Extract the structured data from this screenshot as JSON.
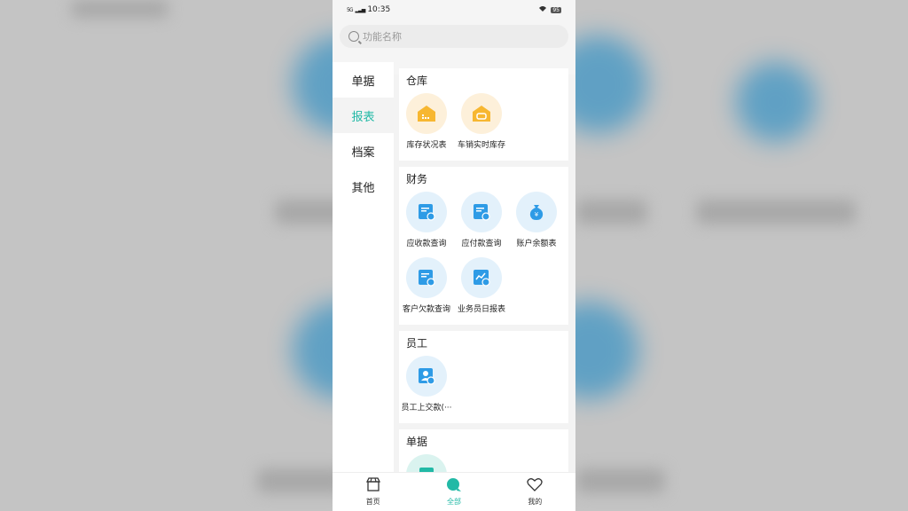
{
  "status_bar": {
    "network": "5G",
    "time": "10:35",
    "battery": "95"
  },
  "search": {
    "placeholder": "功能名称"
  },
  "sidebar": {
    "items": [
      {
        "label": "单据",
        "active": false
      },
      {
        "label": "报表",
        "active": true
      },
      {
        "label": "档案",
        "active": false
      },
      {
        "label": "其他",
        "active": false
      }
    ]
  },
  "sections": [
    {
      "title": "仓库",
      "items": [
        {
          "label": "库存状况表",
          "icon": "warehouse-icon"
        },
        {
          "label": "车销实时库存",
          "icon": "van-inventory-icon"
        }
      ]
    },
    {
      "title": "财务",
      "items": [
        {
          "label": "应收款查询",
          "icon": "receivable-doc-icon"
        },
        {
          "label": "应付款查询",
          "icon": "payable-doc-icon"
        },
        {
          "label": "账户余额表",
          "icon": "money-bag-icon"
        },
        {
          "label": "客户欠款查询",
          "icon": "customer-debt-icon"
        },
        {
          "label": "业务员日报表",
          "icon": "daily-report-icon"
        }
      ]
    },
    {
      "title": "员工",
      "items": [
        {
          "label": "员工上交款(···",
          "icon": "employee-payment-icon"
        }
      ]
    },
    {
      "title": "单据",
      "items": [
        {
          "label": "",
          "icon": "document-icon"
        }
      ]
    }
  ],
  "tabbar": {
    "items": [
      {
        "label": "首页",
        "icon": "store-icon",
        "active": false
      },
      {
        "label": "全部",
        "icon": "all-icon",
        "active": true
      },
      {
        "label": "我的",
        "icon": "heart-icon",
        "active": false
      }
    ]
  },
  "colors": {
    "accent": "#22b9a6",
    "warehouse_yellow": "#f7b731",
    "finance_blue": "#2e9be6"
  }
}
